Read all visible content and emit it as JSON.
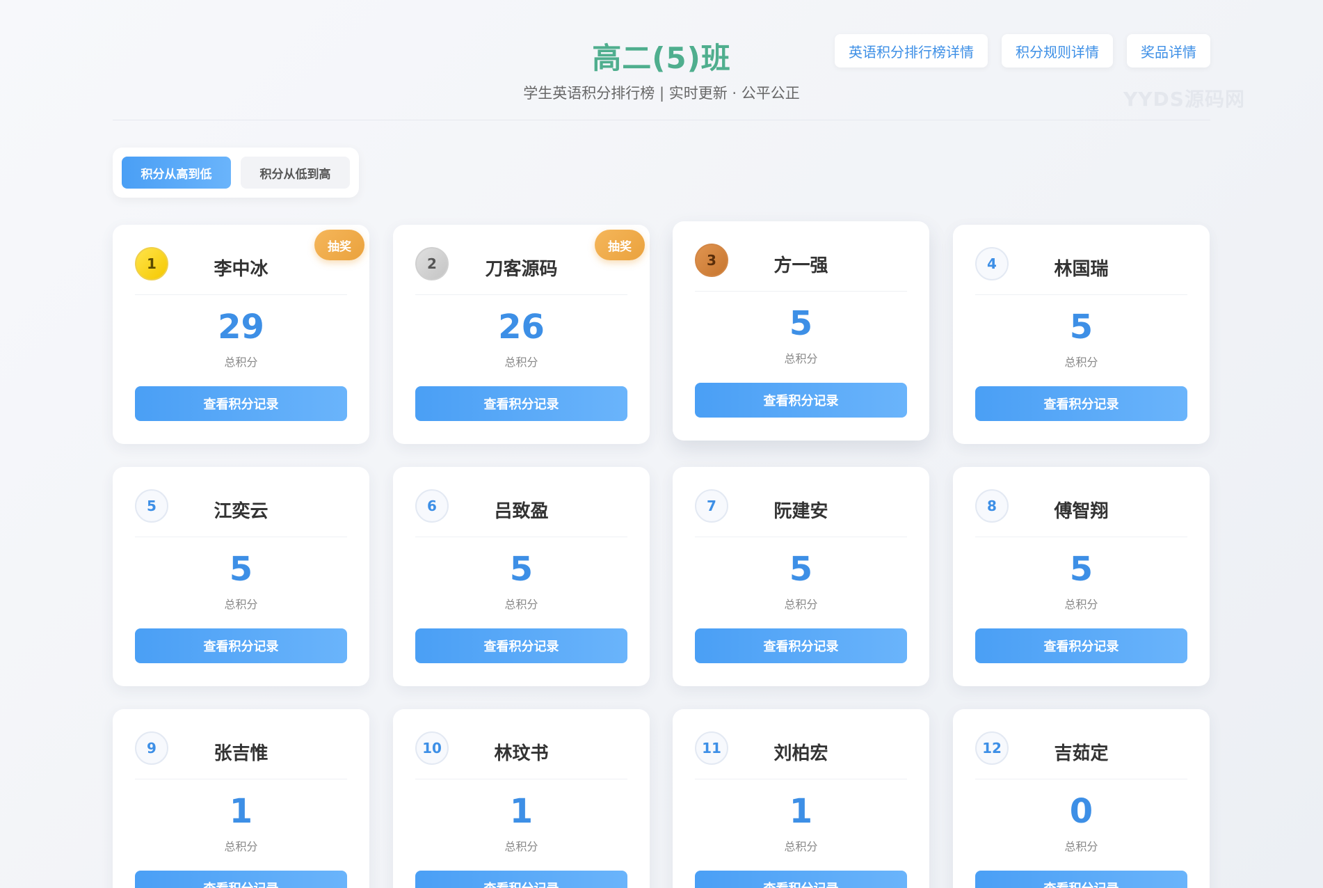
{
  "header": {
    "title": "高二(5)班",
    "subtitle": "学生英语积分排行榜 | 实时更新 · 公平公正",
    "links": [
      "英语积分排行榜详情",
      "积分规则详情",
      "奖品详情"
    ],
    "watermark": "YYDS源码网"
  },
  "sort": {
    "high_to_low": "积分从高到低",
    "low_to_high": "积分从低到高",
    "active": "high_to_low"
  },
  "labels": {
    "score_label": "总积分",
    "record_button": "查看积分记录",
    "lottery_badge": "抽奖"
  },
  "students": [
    {
      "rank": "1",
      "name": "李中冰",
      "score": "29",
      "lottery": true
    },
    {
      "rank": "2",
      "name": "刀客源码",
      "score": "26",
      "lottery": true
    },
    {
      "rank": "3",
      "name": "方一强",
      "score": "5",
      "lottery": false
    },
    {
      "rank": "4",
      "name": "林国瑞",
      "score": "5",
      "lottery": false
    },
    {
      "rank": "5",
      "name": "江奕云",
      "score": "5",
      "lottery": false
    },
    {
      "rank": "6",
      "name": "吕致盈",
      "score": "5",
      "lottery": false
    },
    {
      "rank": "7",
      "name": "阮建安",
      "score": "5",
      "lottery": false
    },
    {
      "rank": "8",
      "name": "傅智翔",
      "score": "5",
      "lottery": false
    },
    {
      "rank": "9",
      "name": "张吉惟",
      "score": "1",
      "lottery": false
    },
    {
      "rank": "10",
      "name": "林玟书",
      "score": "1",
      "lottery": false
    },
    {
      "rank": "11",
      "name": "刘柏宏",
      "score": "1",
      "lottery": false
    },
    {
      "rank": "12",
      "name": "吉茹定",
      "score": "0",
      "lottery": false
    }
  ],
  "colors": {
    "title": "#4fae8e",
    "accent": "#3d8fe6",
    "lottery": "#eaa23d",
    "gold": "#f5c800",
    "silver": "#c4c4c4",
    "bronze": "#c7762f"
  }
}
